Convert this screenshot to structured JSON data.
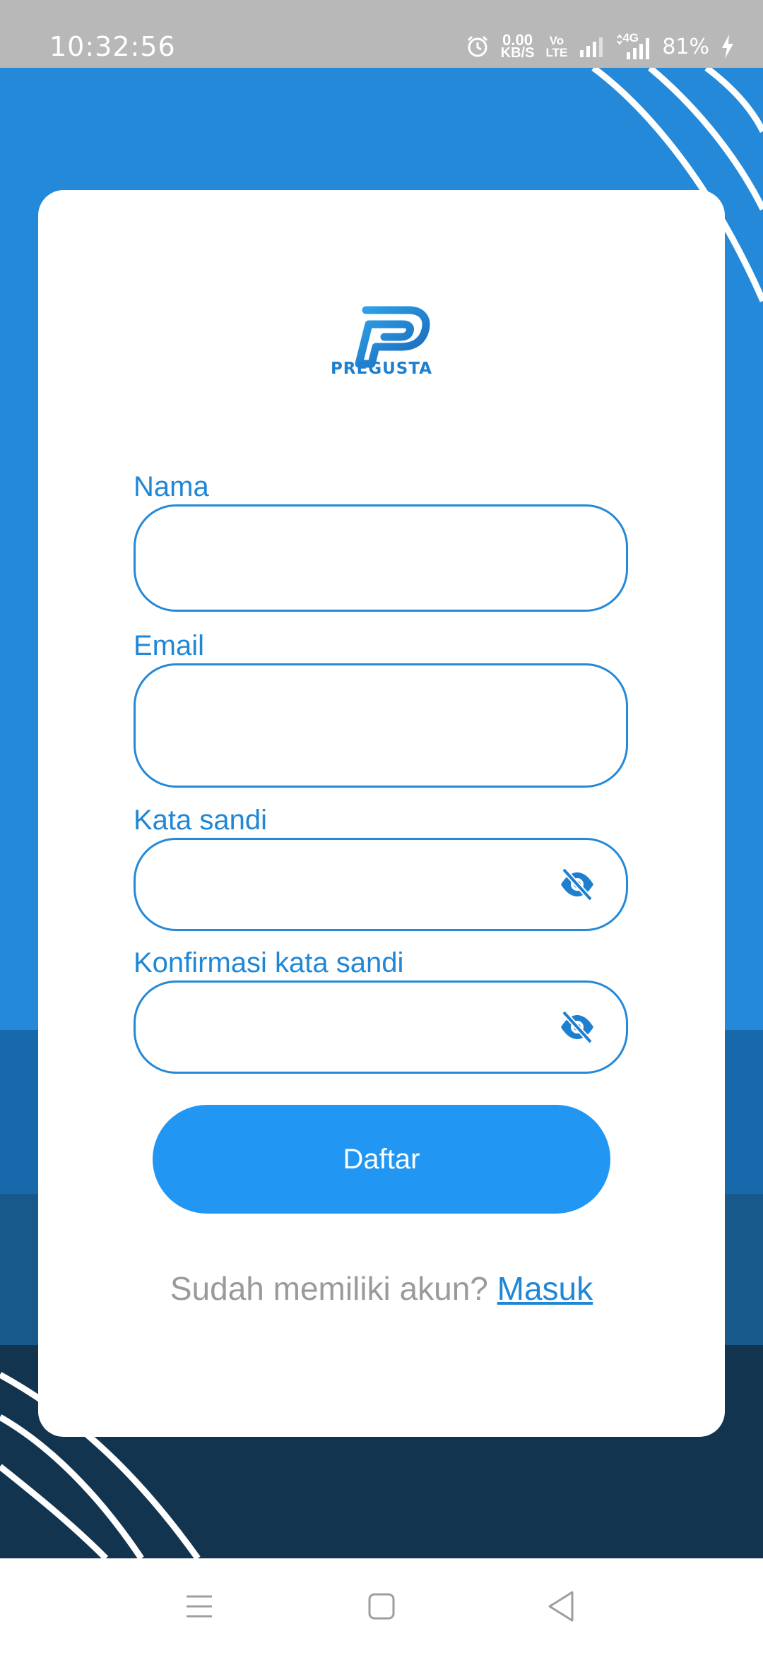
{
  "status_bar": {
    "time": "10:32:56",
    "speed_value": "0.00",
    "speed_unit": "KB/S",
    "volte_top": "Vo",
    "volte_bottom": "LTE",
    "network": "4G",
    "battery": "81%",
    "icons": [
      "alarm-icon",
      "signal-icon",
      "signal-4g-icon",
      "charging-icon"
    ]
  },
  "app": {
    "logo_text": "PREGUSTA",
    "brand_color": "#2389d8"
  },
  "form": {
    "name_label": "Nama",
    "name_value": "",
    "email_label": "Email",
    "email_value": "",
    "password_label": "Kata sandi",
    "password_value": "",
    "confirm_label": "Konfirmasi kata sandi",
    "confirm_value": "",
    "submit_label": "Daftar",
    "visibility_icon": "eye-off-icon"
  },
  "footer": {
    "question": "Sudah memiliki akun?",
    "login_link": "Masuk"
  },
  "nav": {
    "icons": [
      "menu-icon",
      "home-square-icon",
      "back-triangle-icon"
    ]
  }
}
